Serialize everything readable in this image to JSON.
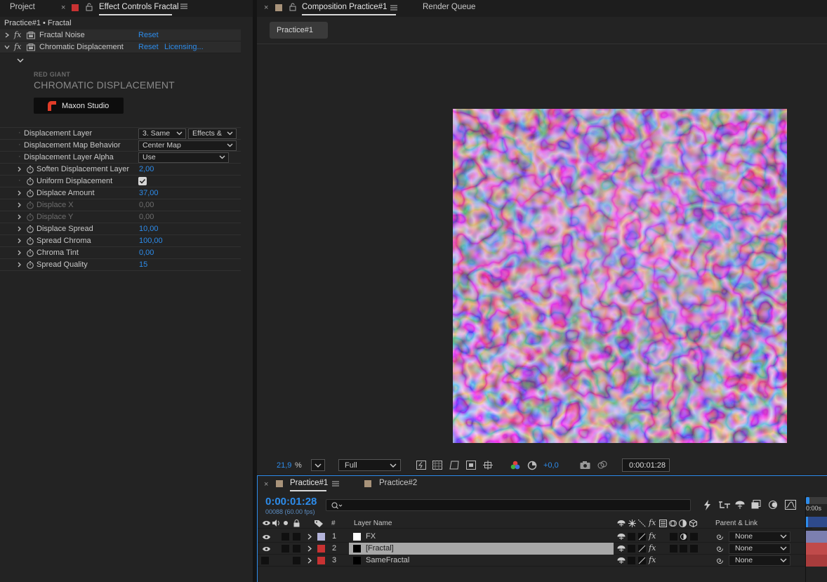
{
  "left_panel": {
    "tabs": [
      "Project",
      "Effect Controls Fractal"
    ],
    "breadcrumb": "Practice#1 • Fractal",
    "effects": [
      {
        "name": "Fractal Noise",
        "reset": "Reset"
      },
      {
        "name": "Chromatic Displacement",
        "reset": "Reset",
        "licensing": "Licensing..."
      }
    ],
    "brand": {
      "vendor": "RED GIANT",
      "product": "CHROMATIC DISPLACEMENT",
      "button": "Maxon Studio"
    },
    "properties": [
      {
        "label": "Displacement Layer",
        "dropdown1": "3. Same",
        "dropdown2": "Effects &"
      },
      {
        "label": "Displacement Map Behavior",
        "dropdown": "Center Map"
      },
      {
        "label": "Displacement Layer Alpha",
        "dropdown": "Use"
      },
      {
        "label": "Soften Displacement Layer",
        "value": "2,00"
      },
      {
        "label": "Uniform Displacement",
        "checked": true
      },
      {
        "label": "Displace Amount",
        "value": "37,00"
      },
      {
        "label": "Displace X",
        "value": "0,00",
        "disabled": true
      },
      {
        "label": "Displace Y",
        "value": "0,00",
        "disabled": true
      },
      {
        "label": "Displace Spread",
        "value": "10,00"
      },
      {
        "label": "Spread Chroma",
        "value": "100,00"
      },
      {
        "label": "Chroma Tint",
        "value": "0,00"
      },
      {
        "label": "Spread Quality",
        "value": "15"
      }
    ]
  },
  "composition": {
    "tabs": [
      "Composition Practice#1",
      "Render Queue"
    ],
    "flowchart_button": "Practice#1",
    "viewer": {
      "zoom": "21,9",
      "zoom_unit": "%",
      "resolution": "Full",
      "exposure": "+0,0",
      "timecode": "0:00:01:28"
    }
  },
  "timeline": {
    "tabs": [
      "Practice#1",
      "Practice#2"
    ],
    "timecode": "0:00:01:28",
    "frame_info": "00088 (60.00 fps)",
    "search_placeholder": "",
    "ruler_label": "0:00s",
    "columns": {
      "number": "#",
      "layer_name": "Layer Name",
      "parent": "Parent & Link"
    },
    "layers": [
      {
        "num": "1",
        "name": "FX",
        "label_color": "#b3b3d9",
        "parent": "None",
        "selected": false
      },
      {
        "num": "2",
        "name": "[Fractal]",
        "label_color": "#c83232",
        "parent": "None",
        "selected": true
      },
      {
        "num": "3",
        "name": "SameFractal",
        "label_color": "#c83232",
        "parent": "None",
        "selected": false
      }
    ]
  },
  "colors": {
    "accent": "#2d8ceb",
    "label_red": "#c83232",
    "brand_red": "#e03c28"
  }
}
